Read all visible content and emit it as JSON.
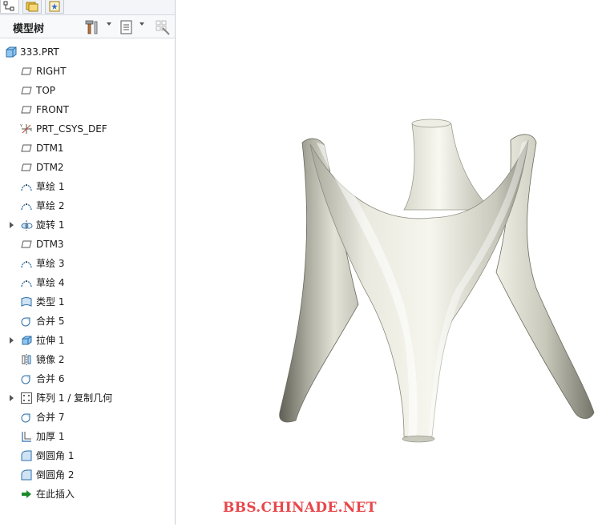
{
  "panel": {
    "title": "模型树"
  },
  "tree": {
    "root": "333.PRT",
    "items": [
      {
        "label": "RIGHT",
        "icon": "datum-plane-icon",
        "expandable": false
      },
      {
        "label": "TOP",
        "icon": "datum-plane-icon",
        "expandable": false
      },
      {
        "label": "FRONT",
        "icon": "datum-plane-icon",
        "expandable": false
      },
      {
        "label": "PRT_CSYS_DEF",
        "icon": "coordinate-system-icon",
        "expandable": false
      },
      {
        "label": "DTM1",
        "icon": "datum-plane-icon",
        "expandable": false
      },
      {
        "label": "DTM2",
        "icon": "datum-plane-icon",
        "expandable": false
      },
      {
        "label": "草绘 1",
        "icon": "sketch-icon",
        "expandable": false
      },
      {
        "label": "草绘 2",
        "icon": "sketch-icon",
        "expandable": false
      },
      {
        "label": "旋转 1",
        "icon": "revolve-icon",
        "expandable": true
      },
      {
        "label": "DTM3",
        "icon": "datum-plane-icon",
        "expandable": false
      },
      {
        "label": "草绘 3",
        "icon": "sketch-icon",
        "expandable": false
      },
      {
        "label": "草绘 4",
        "icon": "sketch-icon",
        "expandable": false
      },
      {
        "label": "类型 1",
        "icon": "style-surface-icon",
        "expandable": false
      },
      {
        "label": "合并 5",
        "icon": "merge-icon",
        "expandable": false
      },
      {
        "label": "拉伸 1",
        "icon": "extrude-icon",
        "expandable": true
      },
      {
        "label": "镜像 2",
        "icon": "mirror-icon",
        "expandable": false
      },
      {
        "label": "合并 6",
        "icon": "merge-icon",
        "expandable": false
      },
      {
        "label": "阵列 1 / 复制几何",
        "icon": "pattern-icon",
        "expandable": true
      },
      {
        "label": "合并 7",
        "icon": "merge-icon",
        "expandable": false
      },
      {
        "label": "加厚 1",
        "icon": "thicken-icon",
        "expandable": false
      },
      {
        "label": "倒圆角 1",
        "icon": "round-icon",
        "expandable": false
      },
      {
        "label": "倒圆角 2",
        "icon": "round-icon",
        "expandable": false
      },
      {
        "label": "在此插入",
        "icon": "insert-here-arrow-icon",
        "expandable": false
      }
    ]
  },
  "watermark": "BBS.CHINADE.NET",
  "colors": {
    "model_surface": "#dcdcd0",
    "model_shadow": "#6f6f63",
    "watermark": "#e8474a",
    "insert_arrow": "#1a8a2a"
  }
}
